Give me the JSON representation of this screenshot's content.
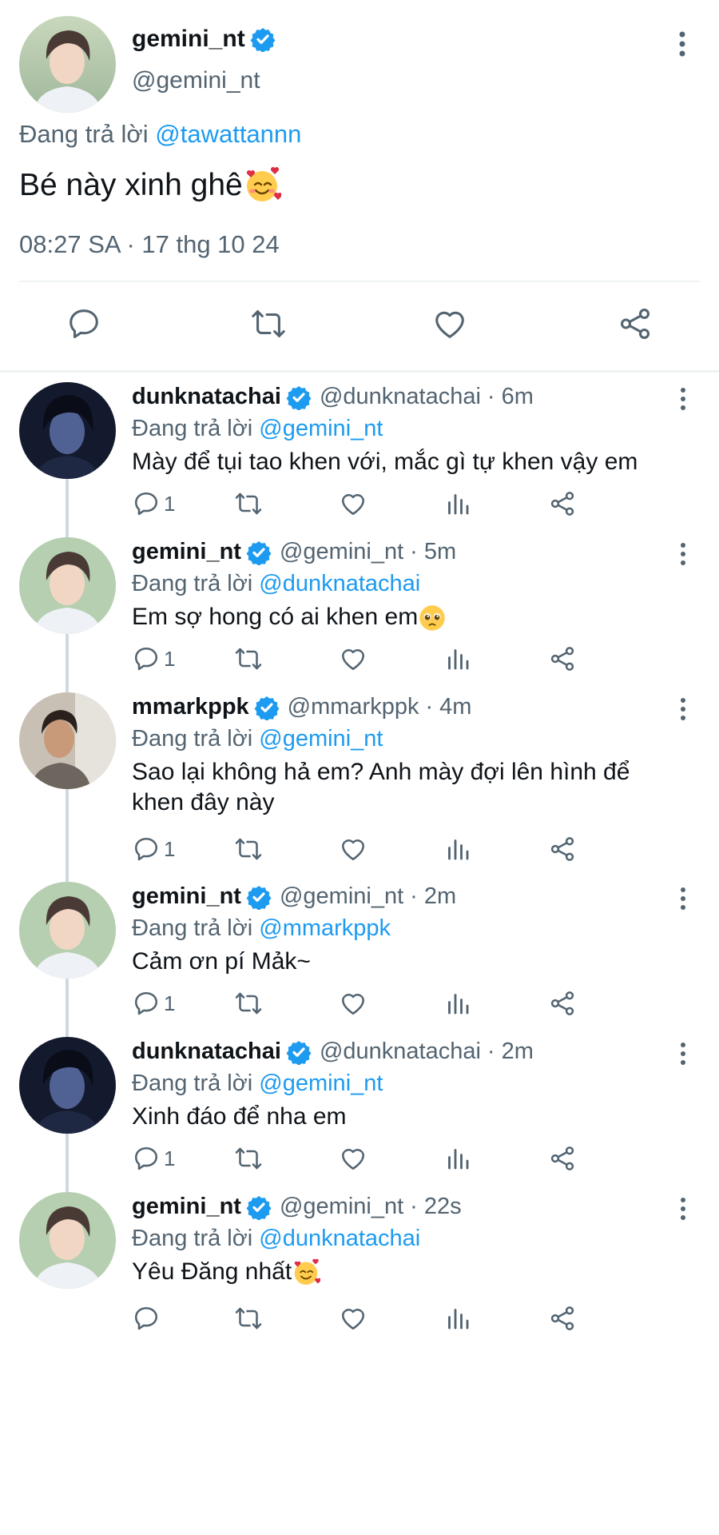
{
  "main_tweet": {
    "author_name": "gemini_nt",
    "author_handle": "@gemini_nt",
    "reply_prefix": "Đang trả lời",
    "reply_mention": "@tawattannn",
    "text": "Bé này xinh ghê",
    "text_emoji": "smiling-face-with-hearts",
    "timestamp": "08:27 SA · 17 thg 10 24",
    "actions": [
      "reply-icon",
      "retweet-icon",
      "like-icon",
      "share-icon"
    ]
  },
  "replies": [
    {
      "author_name": "dunknatachai",
      "author_handle": "@dunknatachai",
      "time": "· 6m",
      "reply_prefix": "Đang trả lời",
      "reply_mention": "@gemini_nt",
      "text": "Mày để tụi tao khen với, mắc gì tự khen vậy em",
      "emoji": "",
      "reply_count": "1",
      "avatar": "dark"
    },
    {
      "author_name": "gemini_nt",
      "author_handle": "@gemini_nt",
      "time": "· 5m",
      "reply_prefix": "Đang trả lời",
      "reply_mention": "@dunknatachai",
      "text": "Em sợ hong có ai khen em",
      "emoji": "pleading-face",
      "reply_count": "1",
      "avatar": "light"
    },
    {
      "author_name": "mmarkppk",
      "author_handle": "@mmarkppk",
      "time": "· 4m",
      "reply_prefix": "Đang trả lời",
      "reply_mention": "@gemini_nt",
      "text": "Sao lại không hả em? Anh mày đợi lên hình để khen đây này",
      "emoji": "",
      "reply_count": "1",
      "avatar": "warm"
    },
    {
      "author_name": "gemini_nt",
      "author_handle": "@gemini_nt",
      "time": "· 2m",
      "reply_prefix": "Đang trả lời",
      "reply_mention": "@mmarkppk",
      "text": "Cảm ơn pí Mảk~",
      "emoji": "",
      "reply_count": "1",
      "avatar": "light"
    },
    {
      "author_name": "dunknatachai",
      "author_handle": "@dunknatachai",
      "time": "· 2m",
      "reply_prefix": "Đang trả lời",
      "reply_mention": "@gemini_nt",
      "text": "Xinh đáo để nha em",
      "emoji": "",
      "reply_count": "1",
      "avatar": "dark"
    },
    {
      "author_name": "gemini_nt",
      "author_handle": "@gemini_nt",
      "time": "· 22s",
      "reply_prefix": "Đang trả lời",
      "reply_mention": "@dunknatachai",
      "text": "Yêu Đăng nhất",
      "emoji": "smiling-face-with-hearts",
      "reply_count": "",
      "avatar": "light"
    }
  ],
  "colors": {
    "accent": "#1d9bf0",
    "text": "#0f1419",
    "muted": "#536471",
    "divider": "#eff3f4",
    "thread_line": "#cfd9de"
  }
}
